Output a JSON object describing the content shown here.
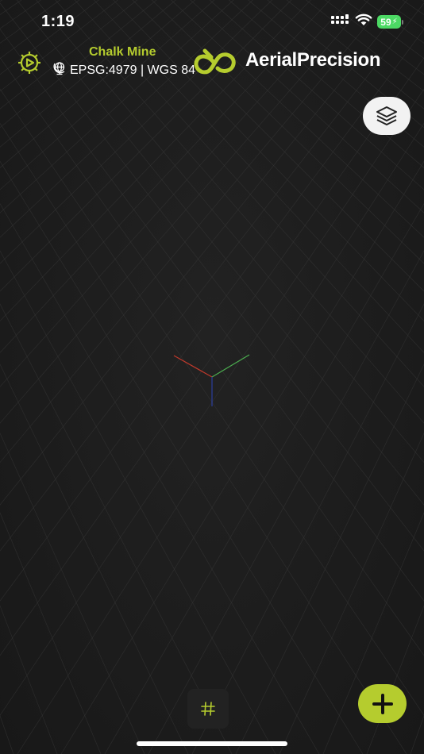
{
  "status_bar": {
    "time": "1:19",
    "battery_level": "59",
    "icons": [
      "cellular-signal-icon",
      "wifi-icon",
      "battery-charging-icon"
    ]
  },
  "header": {
    "project_name": "Chalk Mine",
    "crs_icon": "globe-icon",
    "crs_text": "EPSG:4979 | WGS 84",
    "brand_name": "AerialPrecision",
    "settings_icon": "gear-icon"
  },
  "controls": {
    "layers_icon": "layers-icon",
    "grid_icon": "grid-hash-icon",
    "add_icon": "plus-icon"
  },
  "colors": {
    "accent": "#b5cc2e",
    "background": "#1d1d1d",
    "axis_x": "#c0392b",
    "axis_y": "#4caf50",
    "axis_z": "#2c3e9e"
  }
}
